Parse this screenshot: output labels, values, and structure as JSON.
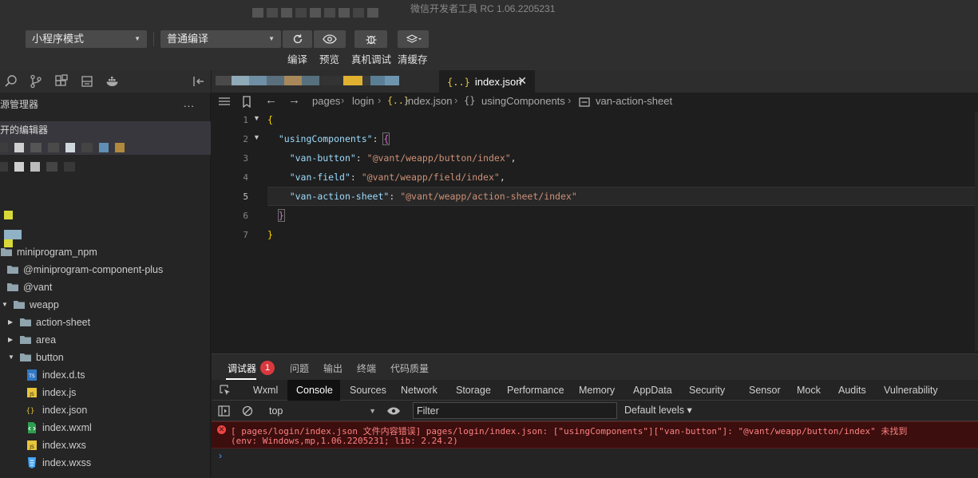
{
  "window": {
    "title": "微信开发者工具 RC 1.06.2205231"
  },
  "toolbar": {
    "mode_select": "小程序模式",
    "compile_select": "普通编译",
    "compile_label": "编译",
    "preview_label": "预览",
    "remote_debug_label": "真机调试",
    "clear_cache_label": "清缓存"
  },
  "sidebar": {
    "explorer_header": "源管理器",
    "more": "...",
    "open_editors": "打开的编辑器",
    "tree": [
      {
        "label": "miniprogram_npm",
        "kind": "folder-open"
      },
      {
        "label": "@miniprogram-component-plus",
        "kind": "folder"
      },
      {
        "label": "@vant",
        "kind": "folder-open"
      },
      {
        "label": "weapp",
        "kind": "folder-open"
      },
      {
        "label": "action-sheet",
        "kind": "folder"
      },
      {
        "label": "area",
        "kind": "folder"
      },
      {
        "label": "button",
        "kind": "folder-open"
      },
      {
        "label": "index.d.ts",
        "kind": "ts"
      },
      {
        "label": "index.js",
        "kind": "js"
      },
      {
        "label": "index.json",
        "kind": "json"
      },
      {
        "label": "index.wxml",
        "kind": "wxml"
      },
      {
        "label": "index.wxs",
        "kind": "wxs"
      },
      {
        "label": "index.wxss",
        "kind": "wxss"
      }
    ]
  },
  "editor": {
    "active_tab": "index.json",
    "close": "✕",
    "tab_icon": "{..}",
    "breadcrumb": {
      "pages": "pages",
      "login": "login",
      "file": "index.json",
      "braces": "{}",
      "using": "usingComponents",
      "sheet": "van-action-sheet",
      "file_icon": "{..}"
    },
    "lines": [
      "1",
      "2",
      "3",
      "4",
      "5",
      "6",
      "7"
    ],
    "code": {
      "open_brace": "{",
      "using_key": "\"usingComponents\"",
      "colon": ": ",
      "inner_open": "{",
      "btn_key": "\"van-button\"",
      "btn_val": "\"@vant/weapp/button/index\"",
      "field_key": "\"van-field\"",
      "field_val": "\"@vant/weapp/field/index\"",
      "sheet_key": "\"van-action-sheet\"",
      "sheet_val": "\"@vant/weapp/action-sheet/index\"",
      "comma": ",",
      "inner_close": "}",
      "close_brace": "}"
    }
  },
  "debugger": {
    "tabs": [
      "调试器",
      "问题",
      "输出",
      "终端",
      "代码质量"
    ],
    "badge": "1",
    "devtools_tabs": [
      "Wxml",
      "Console",
      "Sources",
      "Network",
      "Storage",
      "Performance",
      "Memory",
      "AppData",
      "Security",
      "Sensor",
      "Mock",
      "Audits",
      "Vulnerability"
    ],
    "context": "top",
    "filter_placeholder": "Filter",
    "levels": "Default levels ▾",
    "error_line1": "[ pages/login/index.json 文件内容错误] pages/login/index.json: [\"usingComponents\"][\"van-button\"]: \"@vant/weapp/button/index\" 未找到",
    "error_line2": "(env: Windows,mp,1.06.2205231; lib: 2.24.2)",
    "prompt": "›"
  },
  "colors": {
    "accent_error": "#d9393e",
    "json_key": "#9cdcfe",
    "json_string": "#ce9178"
  }
}
